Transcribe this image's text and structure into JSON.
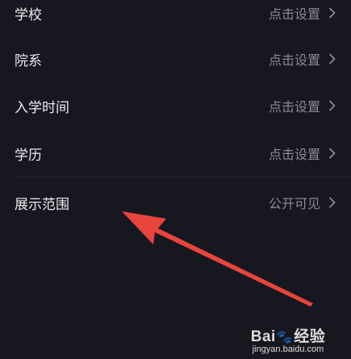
{
  "settings": {
    "rows": [
      {
        "label": "学校",
        "value": "点击设置"
      },
      {
        "label": "院系",
        "value": "点击设置"
      },
      {
        "label": "入学时间",
        "value": "点击设置"
      },
      {
        "label": "学历",
        "value": "点击设置"
      },
      {
        "label": "展示范围",
        "value": "公开可见"
      }
    ]
  },
  "icons": {
    "row_chevron": "chevron-right-icon"
  },
  "colors": {
    "background": "#171720",
    "label_text": "#e9e9ee",
    "value_text": "#8a8a94",
    "annotation_arrow": "#e8453c"
  },
  "watermark": {
    "logo_text_left": "Bai",
    "logo_text_right": "经验",
    "url": "jingyan.baidu.com"
  }
}
